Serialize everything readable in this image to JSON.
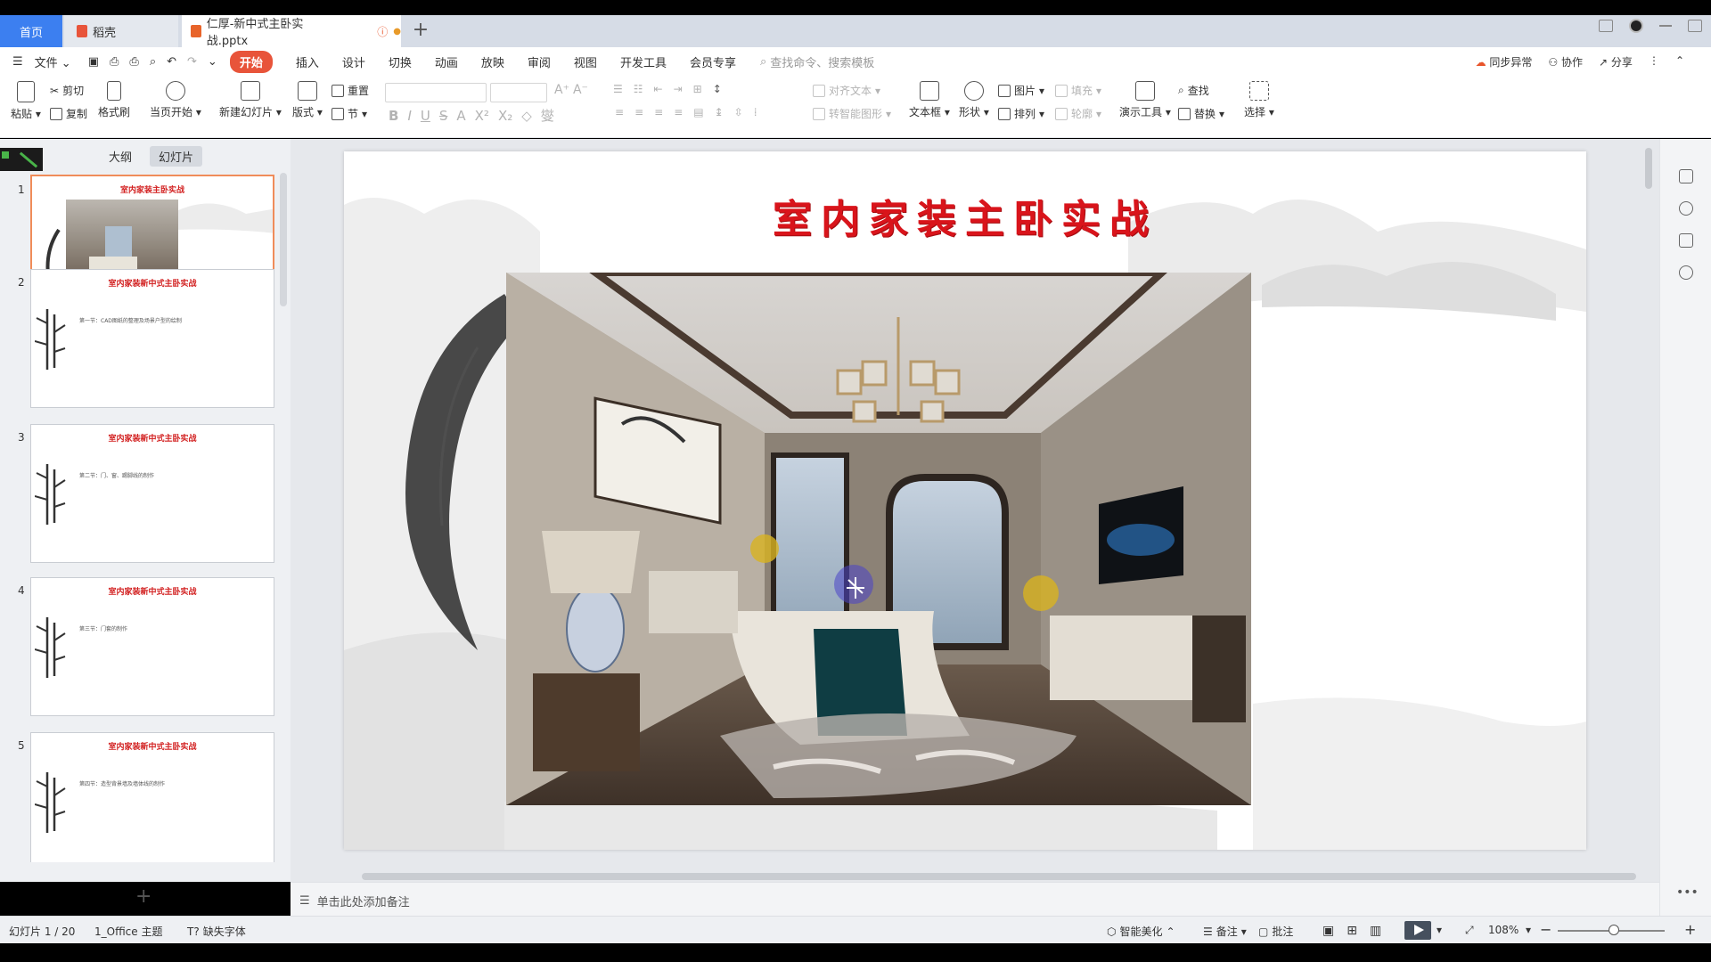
{
  "tabs": {
    "home": "首页",
    "daoke": "稻壳",
    "file": "仁厚-新中式主卧实战.pptx",
    "add": "+"
  },
  "menu": {
    "file": "文件",
    "items": [
      "开始",
      "插入",
      "设计",
      "切换",
      "动画",
      "放映",
      "审阅",
      "视图",
      "开发工具",
      "会员专享"
    ],
    "search_placeholder": "查找命令、搜索模板",
    "right": [
      "同步异常",
      "协作",
      "分享"
    ]
  },
  "ribbon": {
    "paste": "粘贴",
    "cut": "剪切",
    "copy": "复制",
    "format_painter": "格式刷",
    "from_current": "当页开始",
    "new_slide": "新建幻灯片",
    "layout": "版式",
    "reset": "重置",
    "section": "节",
    "align_text": "对齐文本",
    "smart_graphic": "转智能图形",
    "textbox": "文本框",
    "shape": "形状",
    "picture": "图片",
    "fill": "填充",
    "arrange": "排列",
    "outline": "轮廓",
    "presentation_tools": "演示工具",
    "find": "查找",
    "replace": "替换",
    "select": "选择"
  },
  "left_panel": {
    "outline_tab": "大纲",
    "slides_tab": "幻灯片",
    "thumbnails": [
      {
        "num": "1",
        "title": "室内家装主卧实战",
        "text": ""
      },
      {
        "num": "2",
        "title": "室内家装新中式主卧实战",
        "text": "第一节：CAD图纸的整理及场景户型的绘制"
      },
      {
        "num": "3",
        "title": "室内家装新中式主卧实战",
        "text": "第二节：门、窗、踢脚线的制作"
      },
      {
        "num": "4",
        "title": "室内家装新中式主卧实战",
        "text": "第三节：门套的制作"
      },
      {
        "num": "5",
        "title": "室内家装新中式主卧实战",
        "text": "第四节：造型背景墙及墙体线的制作"
      }
    ],
    "add": "+"
  },
  "slide": {
    "title": "室内家装主卧实战"
  },
  "notes": {
    "placeholder": "单击此处添加备注"
  },
  "status": {
    "slide_counter": "幻灯片 1 / 20",
    "theme": "1_Office 主题",
    "missing_font": "缺失字体",
    "smart_beautify": "智能美化",
    "notes": "备注",
    "comments": "批注",
    "zoom": "108%"
  },
  "colors": {
    "accent_blue": "#3c7ff0",
    "start_orange": "#e8543a",
    "title_red": "#d9141b"
  }
}
